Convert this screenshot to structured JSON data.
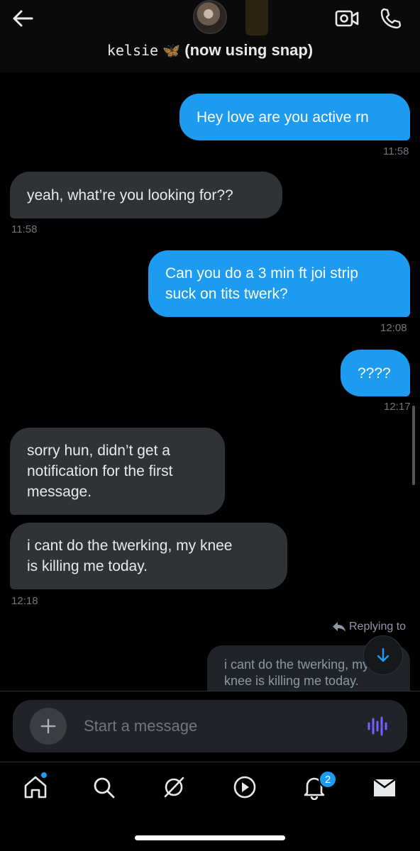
{
  "header": {
    "contact_name_styled": "kelsie",
    "contact_emoji": "🦋",
    "contact_name_rest": "(now using snap)",
    "back_icon": "arrow-left-icon",
    "video_icon": "video-camera-icon",
    "call_icon": "phone-icon"
  },
  "messages": [
    {
      "direction": "sent",
      "text": "Hey love are you active rn",
      "time": "11:58"
    },
    {
      "direction": "received",
      "text": "yeah, what’re you looking for??",
      "time": "11:58"
    },
    {
      "direction": "sent",
      "text_lines": [
        "Can you do a 3 min ft joi strip",
        "suck on tits twerk?"
      ],
      "time": "12:08"
    },
    {
      "direction": "sent",
      "text": "????",
      "time": "12:17"
    },
    {
      "direction": "received",
      "text_lines": [
        "sorry hun, didn’t get a",
        "notification for the first",
        "message."
      ]
    },
    {
      "direction": "received",
      "text_lines": [
        "i cant do the twerking, my knee",
        "is killing me today."
      ],
      "time": "12:18"
    }
  ],
  "reply": {
    "label": "Replying to",
    "quote_line1": "i cant do the twerking, my",
    "quote_line2": "knee is killing me today."
  },
  "composer": {
    "placeholder": "Start a message"
  },
  "tabbar": {
    "notification_count": "2",
    "items": [
      "home-icon",
      "search-icon",
      "grok-icon",
      "video-play-icon",
      "bell-icon",
      "mail-icon"
    ]
  },
  "colors": {
    "accent": "#1d9bf0",
    "received_bubble": "#2f3336",
    "voice_accent": "#7b5cff"
  }
}
